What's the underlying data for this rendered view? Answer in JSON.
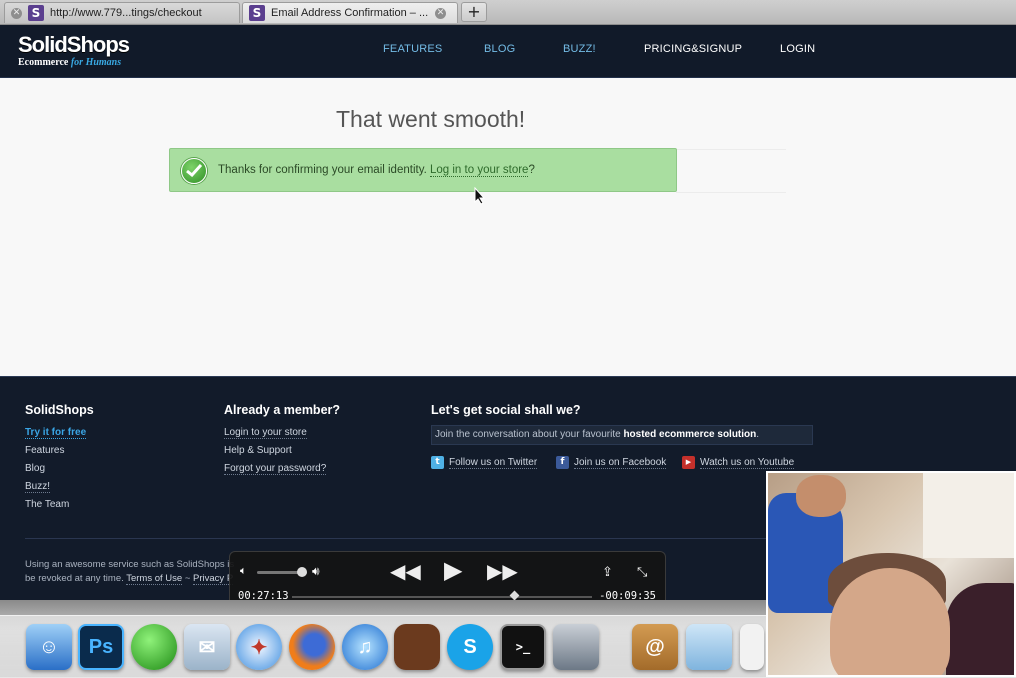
{
  "browser": {
    "tabs": [
      {
        "title": "http://www.779...tings/checkout",
        "favicon": "S"
      },
      {
        "title": "Email Address Confirmation – ...",
        "favicon": "S"
      }
    ],
    "new_tab": "+"
  },
  "header": {
    "logo_main": "SolidShops",
    "logo_tag_prefix": "Ecommerce",
    "logo_tag_highlight": "for Humans",
    "nav": [
      "FEATURES",
      "BLOG",
      "BUZZ!",
      "PRICING&SIGNUP",
      "LOGIN"
    ]
  },
  "main": {
    "heading": "That went smooth!",
    "alert_text": "Thanks for confirming your email identity.",
    "alert_link": "Log in to your store",
    "alert_suffix": "?"
  },
  "footer": {
    "col1": {
      "title": "SolidShops",
      "links": [
        "Try it for free",
        "Features",
        "Blog",
        "Buzz!",
        "The Team"
      ]
    },
    "col2": {
      "title": "Already a member?",
      "links": [
        "Login to your store",
        "Help & Support",
        "Forgot your password?"
      ]
    },
    "col3": {
      "title": "Let's get social shall we?",
      "box_text": "Join the conversation about your favourite",
      "box_bold": "hosted ecommerce solution",
      "box_end": ".",
      "twitter": "Follow us on Twitter",
      "facebook": "Join us on Facebook",
      "youtube": "Watch us on Youtube"
    },
    "legal_line1": "Using an awesome service such as SolidShops is",
    "legal_line2_prefix": "be revoked at any time.",
    "legal_terms": "Terms of Use",
    "legal_sep": "~",
    "legal_privacy": "Privacy P"
  },
  "player": {
    "elapsed": "00:27:13",
    "remaining": "-00:09:35",
    "progress": 0.74
  },
  "dock": {
    "icons": [
      "finder-icon",
      "photoshop-icon",
      "green-ball-icon",
      "bird-mail-icon",
      "safari-icon",
      "firefox-icon",
      "itunes-icon",
      "domo-icon",
      "skype-icon",
      "terminal-icon",
      "gorilla-icon",
      "address-book-icon",
      "folder-icon",
      "document-icon"
    ],
    "ps_label": "Ps"
  }
}
